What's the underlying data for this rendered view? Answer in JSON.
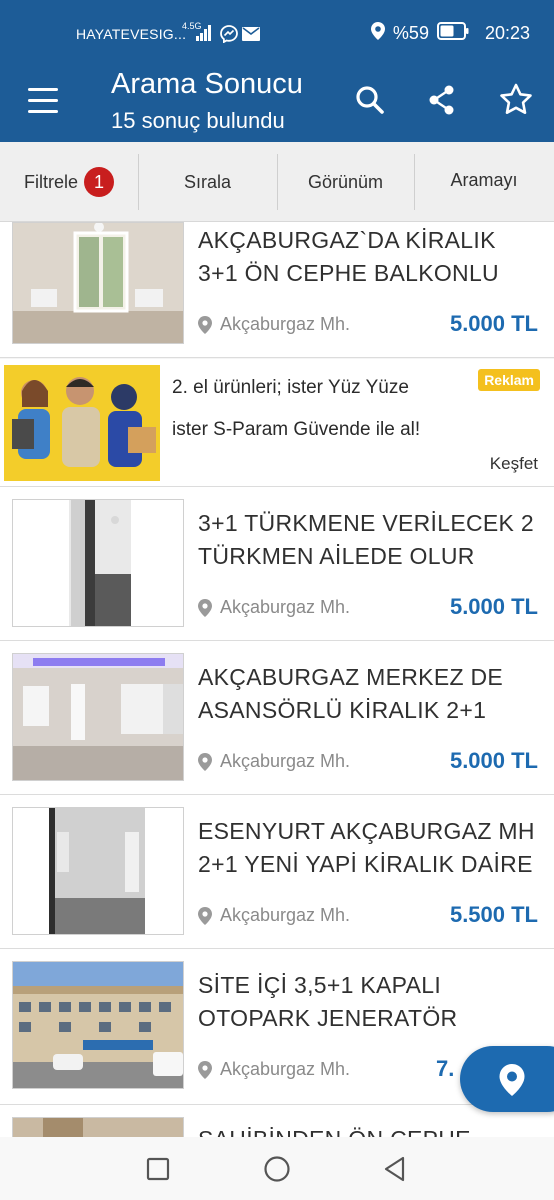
{
  "status_bar": {
    "carrier": "HAYATEVESIG...",
    "network": "4.5G",
    "signal_icon": "signal-icon",
    "messenger_icon": "messenger-icon",
    "mail_icon": "mail-icon",
    "location_icon": "location-icon",
    "battery": "%59",
    "battery_level_percent": 59,
    "time": "20:23"
  },
  "header": {
    "title": "Arama Sonucu",
    "subtitle": "15 sonuç bulundu",
    "icons": [
      "menu-icon",
      "search-icon",
      "share-icon",
      "star-icon"
    ],
    "color": "#1d5c97"
  },
  "tabs": [
    {
      "label": "Filtrele",
      "badge": "1"
    },
    {
      "label": "Sırala"
    },
    {
      "label": "Görünüm"
    },
    {
      "label": "Aramayı"
    }
  ],
  "listings": [
    {
      "title_line1": "AKÇABURGAZ`DA KİRALIK",
      "title_line2": "3+1 ÖN CEPHE BALKONLU",
      "location": "Akçaburgaz Mh.",
      "price": "5.000 TL"
    },
    {
      "title_line1": "3+1 TÜRKMENE VERİLECEK 2",
      "title_line2": "TÜRKMEN AİLEDE OLUR",
      "location": "Akçaburgaz Mh.",
      "price": "5.000 TL"
    },
    {
      "title_line1": "AKÇABURGAZ MERKEZ DE",
      "title_line2": "ASANSÖRLÜ KİRALIK 2+1",
      "location": "Akçaburgaz Mh.",
      "price": "5.000 TL"
    },
    {
      "title_line1": "ESENYURT AKÇABURGAZ MH",
      "title_line2": "2+1 YENİ YAPİ KİRALIK DAİRE",
      "location": "Akçaburgaz Mh.",
      "price": "5.500 TL"
    },
    {
      "title_line1": "SİTE İÇİ 3,5+1 KAPALI",
      "title_line2": "OTOPARK JENERATÖR",
      "location": "Akçaburgaz Mh.",
      "price": "7."
    },
    {
      "title_line1": "SAHİBİNDEN ÖN CEPHE"
    }
  ],
  "ad": {
    "line1": "2. el ürünleri; ister Yüz Yüze",
    "line2": "ister S-Param Güvende ile al!",
    "badge": "Reklam",
    "cta": "Keşfet"
  },
  "accent_color": "#1d6ab0",
  "fab": {
    "icon": "map-pin-icon"
  },
  "nav": {
    "icons": [
      "recent-apps-icon",
      "home-icon",
      "back-icon"
    ]
  }
}
